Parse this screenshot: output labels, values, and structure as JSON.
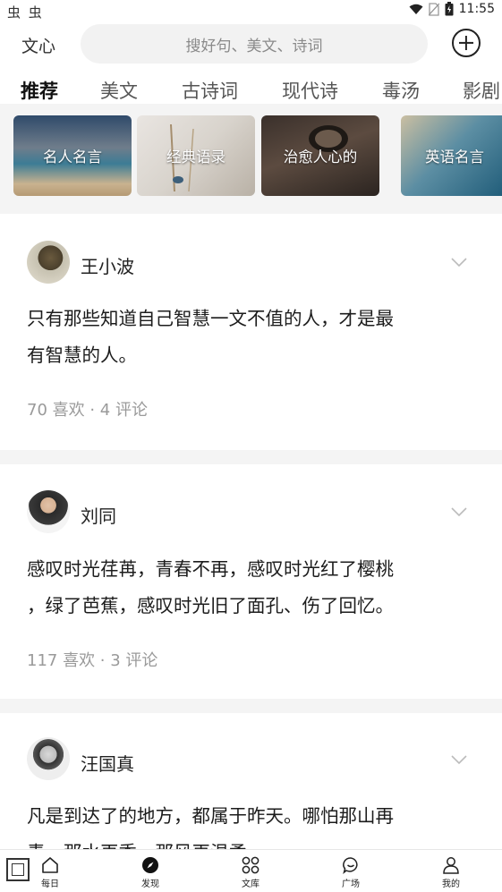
{
  "status_bar": {
    "left_icons": "虫 虫",
    "time": "11:55"
  },
  "header": {
    "logo": "文心",
    "search_placeholder": "搜好句、美文、诗词"
  },
  "tabs": [
    "推荐",
    "美文",
    "古诗词",
    "现代诗",
    "毒汤",
    "影剧"
  ],
  "categories": [
    "名人名言",
    "经典语录",
    "治愈人心的",
    "英语名言"
  ],
  "posts": [
    {
      "author": "王小波",
      "content_lines": [
        "只有那些知道自己智慧一文不值的人，才是最",
        "有智慧的人。"
      ],
      "meta": "70 喜欢 · 4 评论"
    },
    {
      "author": "刘同",
      "content_lines": [
        "感叹时光荏苒，青春不再，感叹时光红了樱桃",
        "，绿了芭蕉，感叹时光旧了面孔、伤了回忆。"
      ],
      "meta": "117 喜欢 · 3 评论"
    },
    {
      "author": "汪国真",
      "content_lines": [
        "凡是到达了的地方，都属于昨天。哪怕那山再",
        "青，那水再秀，那风再温柔"
      ]
    }
  ],
  "bottom_nav": [
    {
      "label": "每日",
      "icon": "home-icon"
    },
    {
      "label": "发现",
      "icon": "compass-icon"
    },
    {
      "label": "文库",
      "icon": "grid-icon"
    },
    {
      "label": "广场",
      "icon": "chat-icon"
    },
    {
      "label": "我的",
      "icon": "user-icon"
    }
  ],
  "colors": {
    "background": "#ffffff",
    "divider": "#f4f4f4",
    "search_bg": "#f2f2f2",
    "meta_text": "#9a9a9a"
  }
}
